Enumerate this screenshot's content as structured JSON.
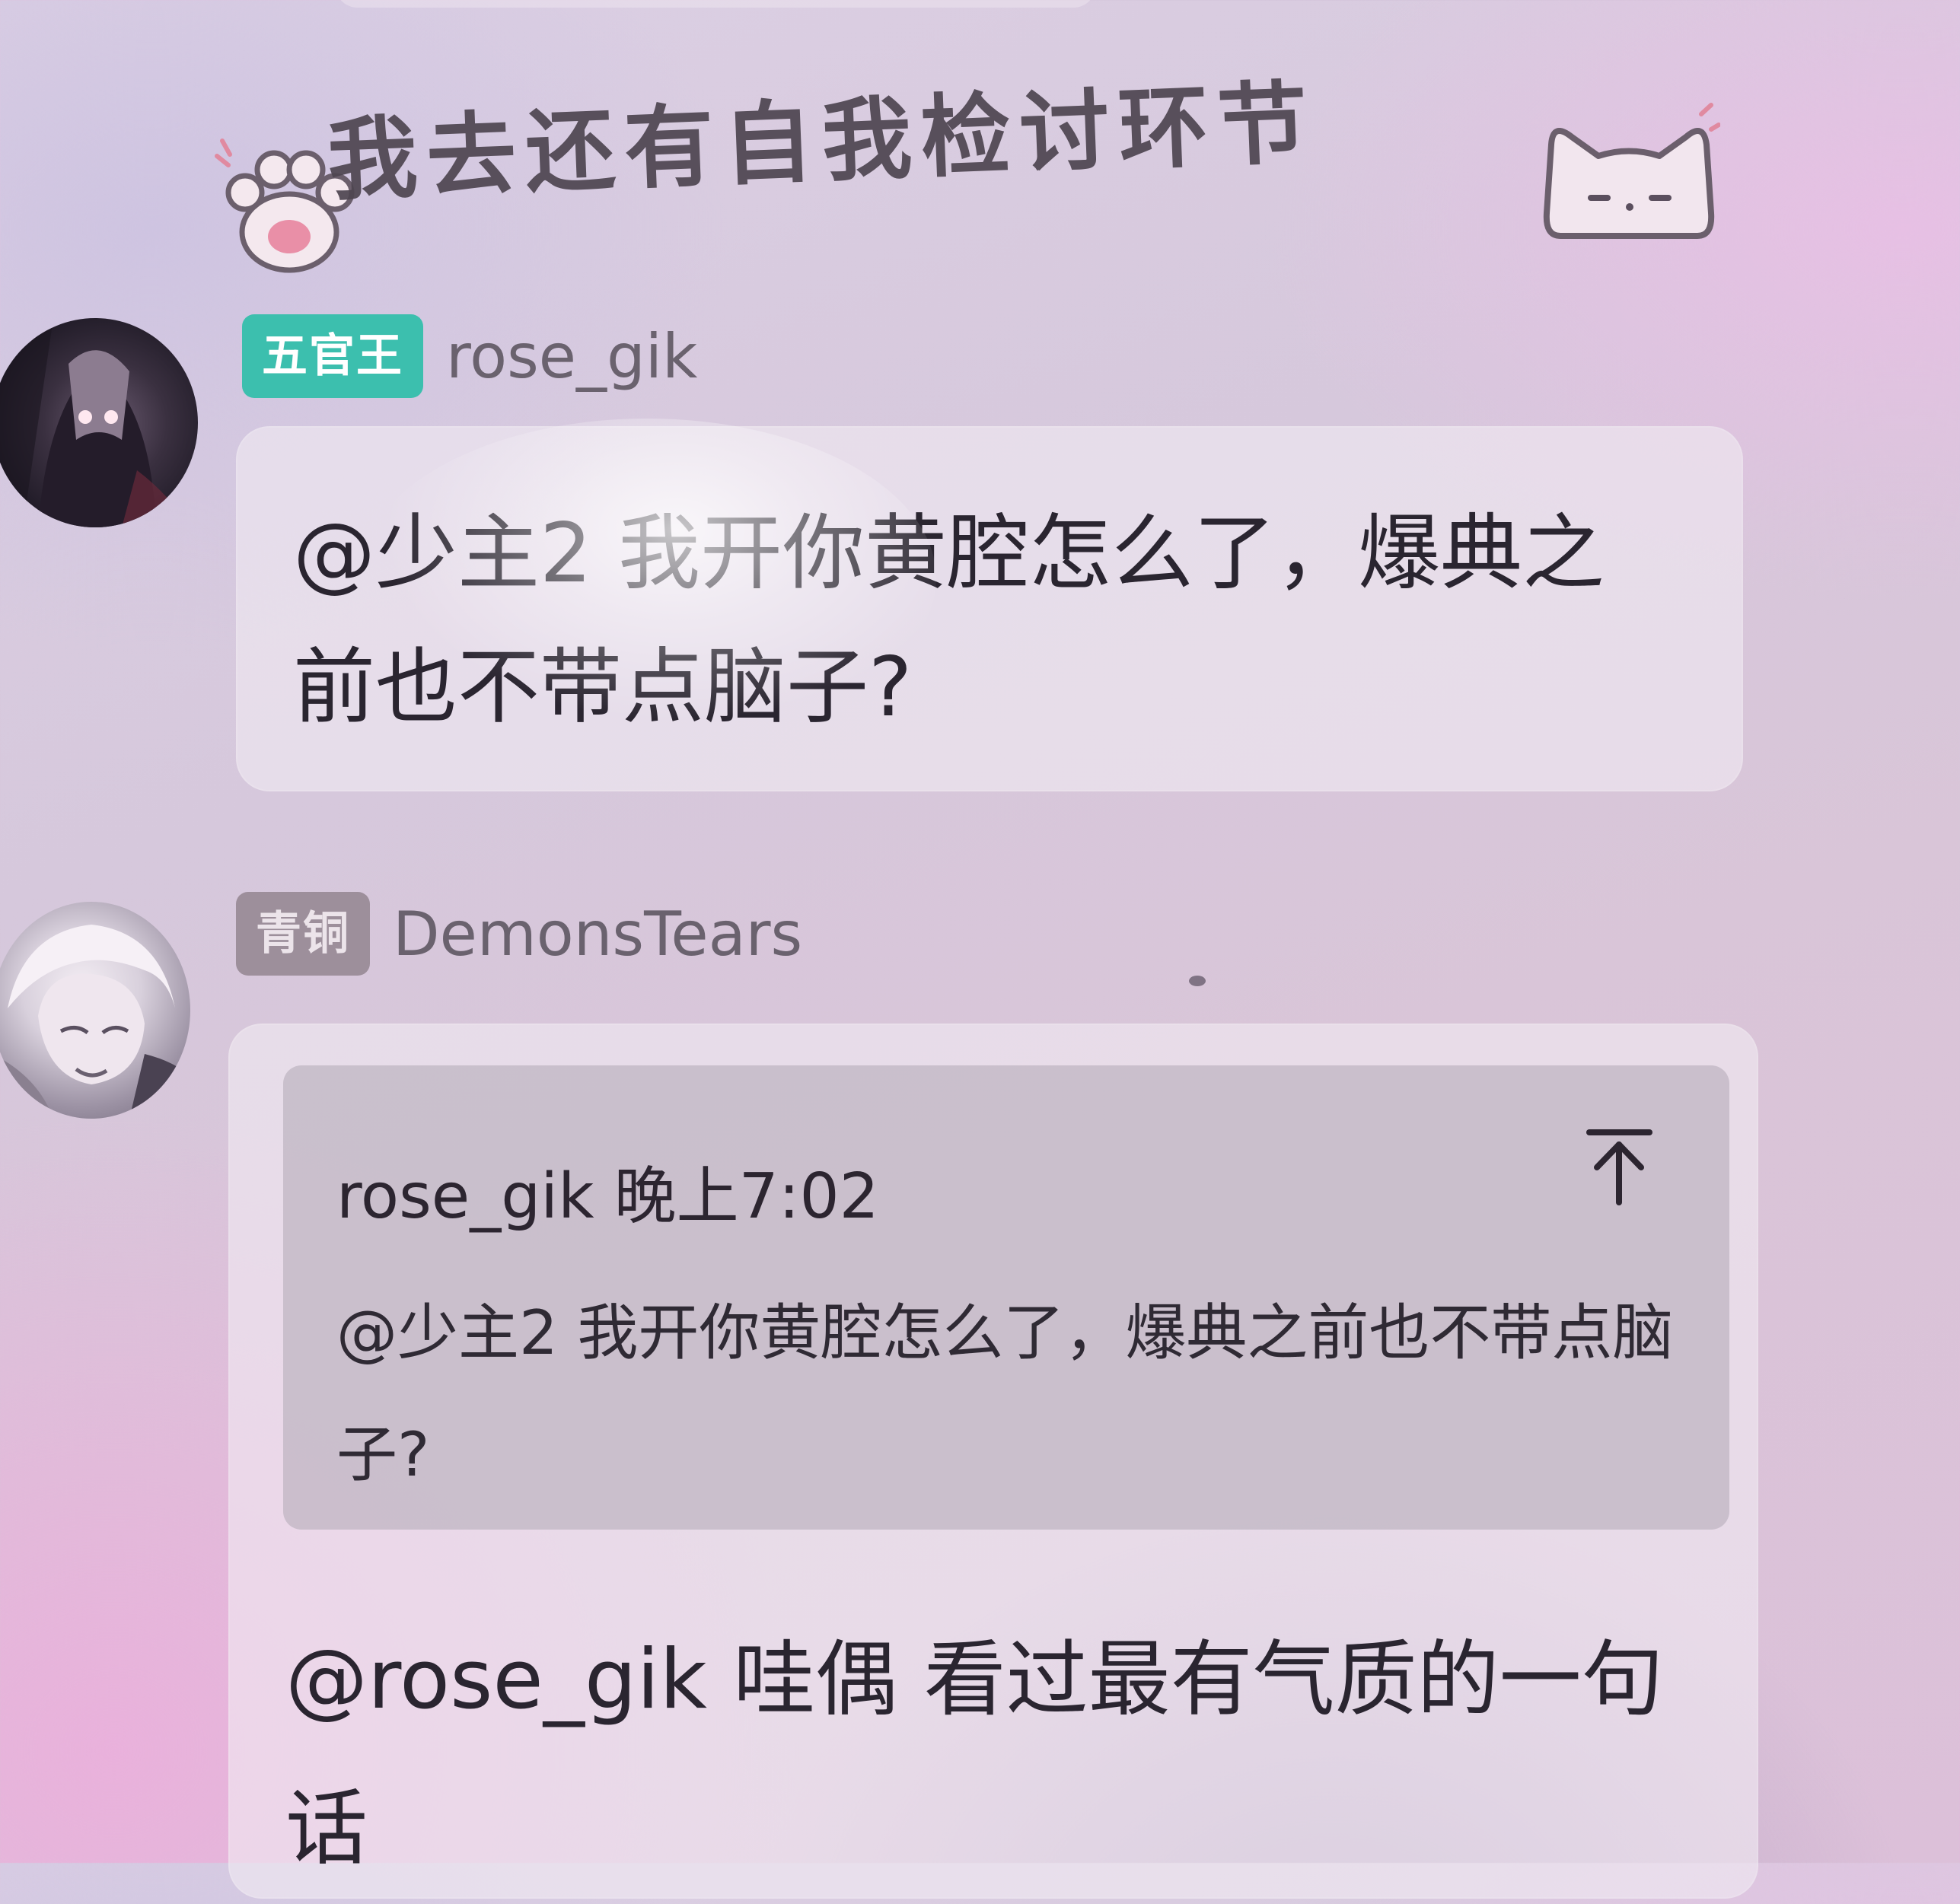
{
  "sticker": {
    "text": "我去还有自我检讨环节",
    "left_icon": "paw-icon",
    "right_icon": "cat-face-icon"
  },
  "messages": [
    {
      "badge": "五官王",
      "badge_color": "#3cbfae",
      "username": "rose_gik",
      "text": "@少主2 我开你黄腔怎么了，爆典之前也不带点脑子?"
    },
    {
      "badge": "青铜",
      "badge_color": "#9d8f9b",
      "username": "DemonsTears",
      "quote": {
        "author": "rose_gik",
        "time": "晚上7:02",
        "text": "@少主2 我开你黄腔怎么了，爆典之前也不带点脑子?",
        "jump_icon": "jump-to-top-icon"
      },
      "text": "@rose_gik 哇偶 看过最有气质的一句话"
    }
  ]
}
